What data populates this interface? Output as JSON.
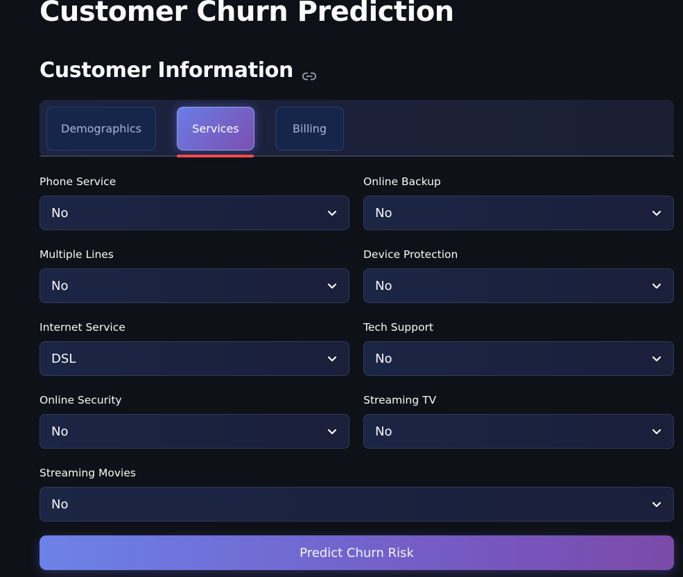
{
  "page": {
    "title": "Customer Churn Prediction",
    "section_heading": "Customer Information"
  },
  "tabs": [
    {
      "label": "Demographics",
      "active": false
    },
    {
      "label": "Services",
      "active": true
    },
    {
      "label": "Billing",
      "active": false
    }
  ],
  "fields": {
    "phone_service": {
      "label": "Phone Service",
      "value": "No"
    },
    "online_backup": {
      "label": "Online Backup",
      "value": "No"
    },
    "multiple_lines": {
      "label": "Multiple Lines",
      "value": "No"
    },
    "device_protection": {
      "label": "Device Protection",
      "value": "No"
    },
    "internet_service": {
      "label": "Internet Service",
      "value": "DSL"
    },
    "tech_support": {
      "label": "Tech Support",
      "value": "No"
    },
    "online_security": {
      "label": "Online Security",
      "value": "No"
    },
    "streaming_tv": {
      "label": "Streaming TV",
      "value": "No"
    },
    "streaming_movies": {
      "label": "Streaming Movies",
      "value": "No"
    }
  },
  "actions": {
    "predict_label": "Predict Churn Risk"
  },
  "icons": {
    "heading_link": "link-icon",
    "select_arrow": "chevron-down-icon"
  },
  "colors": {
    "background": "#0e1117",
    "accent_start": "#6b82e8",
    "accent_end": "#7b4aa8",
    "tab_indicator": "#ff4b4b"
  }
}
